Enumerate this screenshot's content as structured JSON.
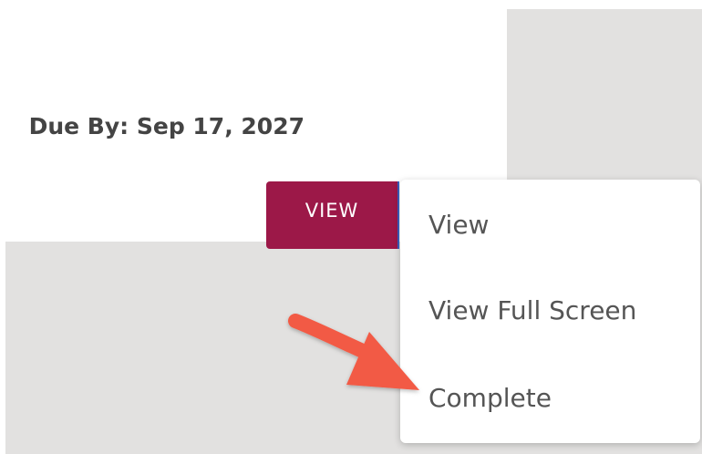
{
  "task": {
    "due_by": "Due By: Sep 17, 2027"
  },
  "actions": {
    "view_button_label": "VIEW"
  },
  "dropdown_menu": {
    "items": [
      {
        "label": "View"
      },
      {
        "label": "View Full Screen"
      },
      {
        "label": "Complete"
      }
    ]
  },
  "colors": {
    "primary_button": "#9c1848",
    "annotation_arrow": "#f25a44",
    "panel_gray": "#e2e1e0"
  },
  "annotation": {
    "icon": "red-arrow-pointing-to-complete"
  }
}
